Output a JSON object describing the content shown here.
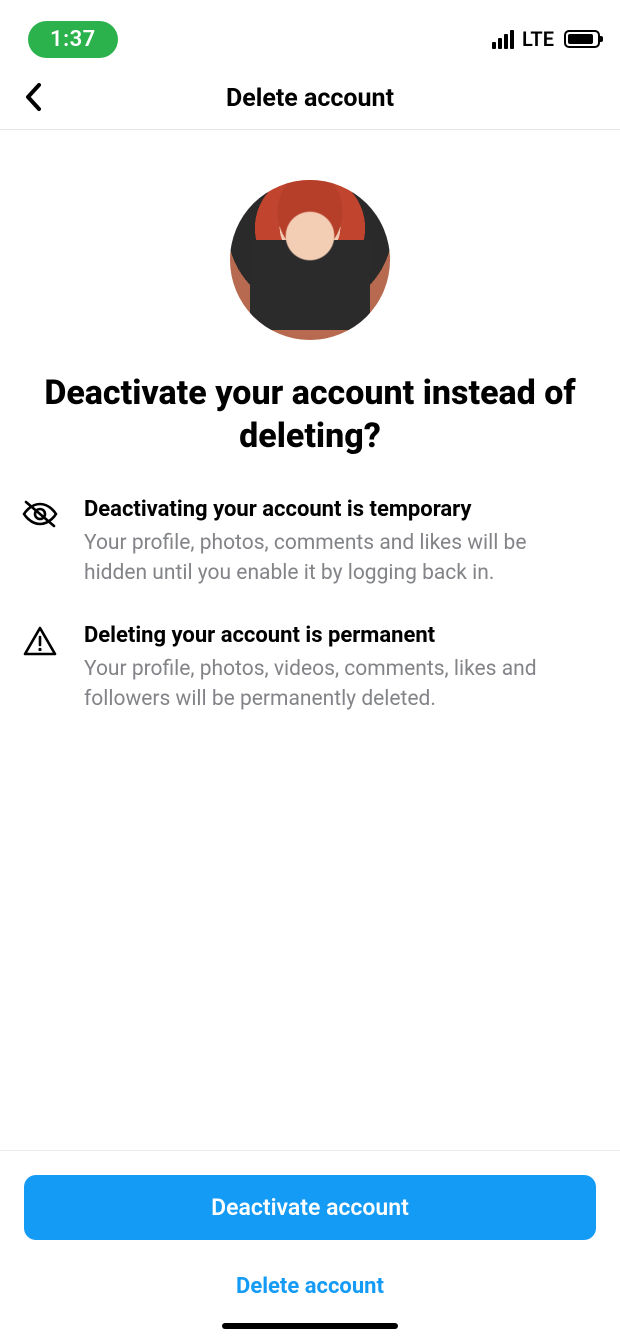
{
  "status_bar": {
    "time": "1:37",
    "network_label": "LTE"
  },
  "header": {
    "title": "Delete account"
  },
  "main": {
    "heading": "Deactivate your account instead of deleting?",
    "items": [
      {
        "icon": "eye-slash-icon",
        "title": "Deactivating your account is temporary",
        "desc": "Your profile, photos, comments and likes will be hidden until you enable it by logging back in."
      },
      {
        "icon": "warning-triangle-icon",
        "title": "Deleting your account is permanent",
        "desc": "Your profile, photos, videos, comments, likes and followers will be permanently deleted."
      }
    ]
  },
  "footer": {
    "primary_label": "Deactivate account",
    "secondary_label": "Delete account"
  }
}
